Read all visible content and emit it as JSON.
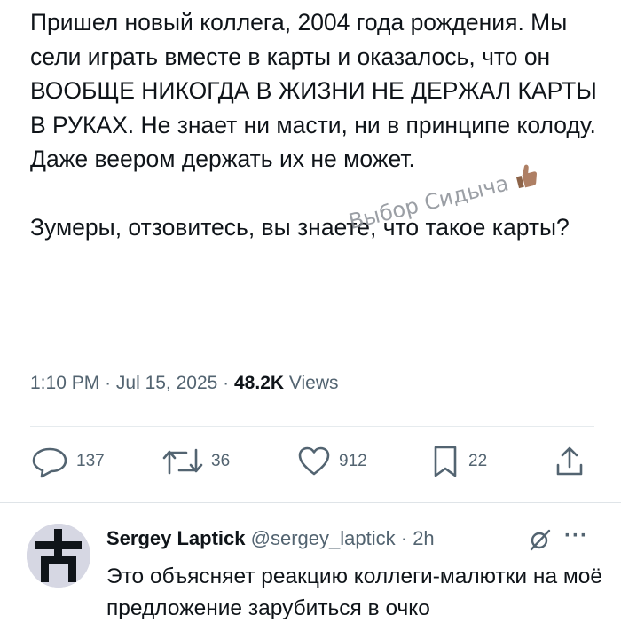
{
  "tweet": {
    "paragraph1": "Пришел новый коллега, 2004 года рождения. Мы сели играть вместе в карты и оказалось, что он ВООБЩЕ НИКОГДА В ЖИЗНИ НЕ ДЕРЖАЛ КАРТЫ В РУКАХ. Не знает ни масти, ни в принципе колоду. Даже веером держать их не может.",
    "paragraph2": "Зумеры, отзовитесь, вы знаете, что такое карты?",
    "watermark": "Выбор Сидыча",
    "time": "1:10 PM",
    "date": "Jul 15, 2025",
    "views_count": "48.2K",
    "views_label": "Views"
  },
  "actions": {
    "replies": "137",
    "reposts": "36",
    "likes": "912",
    "bookmarks": "22"
  },
  "reply": {
    "name": "Sergey Laptick",
    "handle": "@sergey_laptick",
    "time": "2h",
    "text": "Это объясняет реакцию коллеги-малютки на моё предложение зарубиться в очко"
  },
  "icons": [
    "reply-icon",
    "repost-icon",
    "like-icon",
    "bookmark-icon",
    "share-icon",
    "grok-icon",
    "more-icon",
    "thumbs-up-emoji"
  ]
}
